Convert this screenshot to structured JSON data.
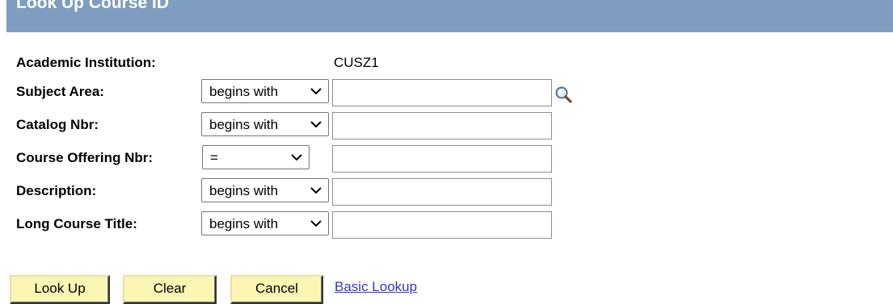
{
  "title": "Look Up Course ID",
  "fields": [
    {
      "label": "Academic Institution:",
      "value": "CUSZ1"
    },
    {
      "label": "Subject Area:",
      "operator": "begins with",
      "value": ""
    },
    {
      "label": "Catalog Nbr:",
      "operator": "begins with",
      "value": ""
    },
    {
      "label": "Course Offering Nbr:",
      "operator": "=",
      "value": ""
    },
    {
      "label": "Description:",
      "operator": "begins with",
      "value": ""
    },
    {
      "label": "Long Course Title:",
      "operator": "begins with",
      "value": ""
    }
  ],
  "icons": {
    "lookup": "magnifier-icon",
    "dropdown": "chevron-down-icon"
  },
  "buttons": {
    "lookup": "Look Up",
    "clear": "Clear",
    "cancel": "Cancel"
  },
  "links": {
    "basic_lookup": "Basic Lookup"
  },
  "colors": {
    "title_bar": "#7e9dc0",
    "button_bg": "#fcf6b4",
    "link": "#3333cc"
  }
}
